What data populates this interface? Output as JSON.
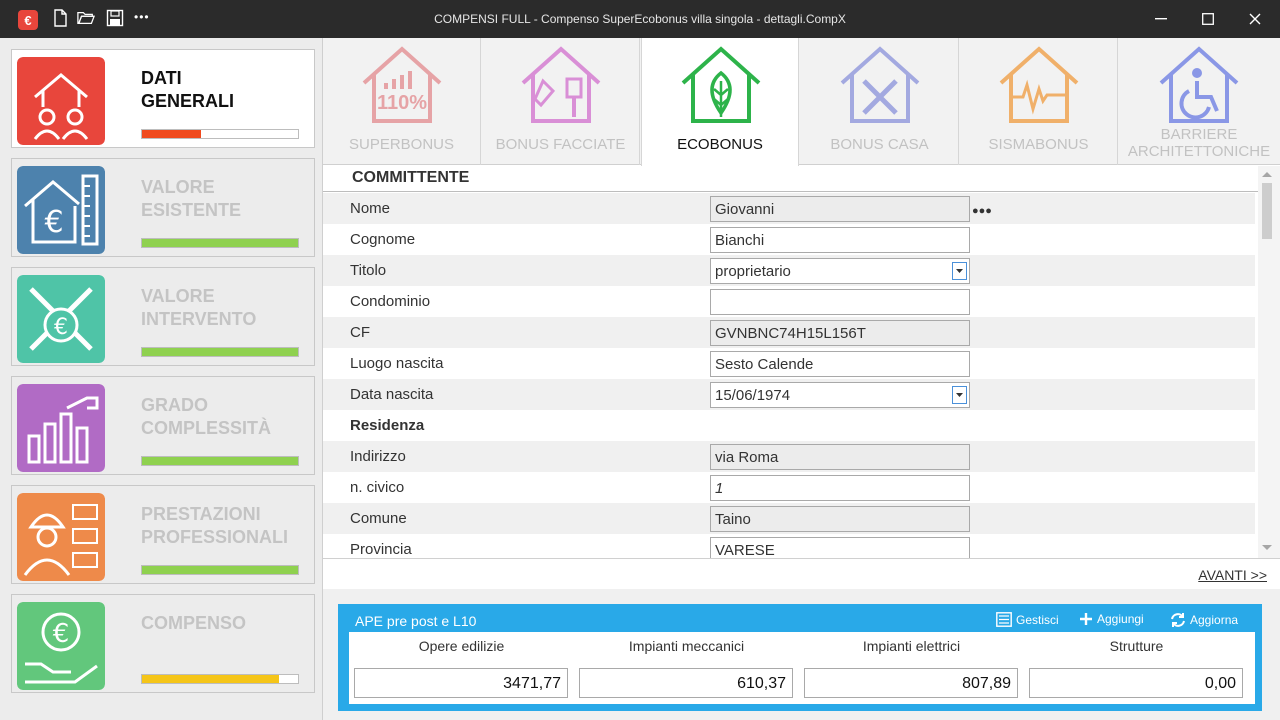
{
  "window": {
    "title": "COMPENSI FULL - Compenso SuperEcobonus villa singola - dettagli.CompX",
    "logo_glyph": "€",
    "more_glyph": "•••"
  },
  "sidebar": {
    "items": [
      {
        "label": "DATI\nGENERALI",
        "icon": "house-workers-icon",
        "color": "#e8463c",
        "progress": 0.38,
        "bar_color": "#f04a1e",
        "active": true
      },
      {
        "label": "VALORE\nESISTENTE",
        "icon": "house-euro-ruler-icon",
        "color": "#4d82ad",
        "progress": 1.0,
        "bar_color": "#8fd14f",
        "active": false
      },
      {
        "label": "VALORE\nINTERVENTO",
        "icon": "tools-euro-icon",
        "color": "#4fc4a7",
        "progress": 1.0,
        "bar_color": "#8fd14f",
        "active": false
      },
      {
        "label": "GRADO\nCOMPLESSITÀ",
        "icon": "bar-graph-icon",
        "color": "#b16bc5",
        "progress": 1.0,
        "bar_color": "#8fd14f",
        "active": false
      },
      {
        "label": "PRESTAZIONI\nPROFESSIONALI",
        "icon": "worker-invoice-icon",
        "color": "#ee8a4a",
        "progress": 1.0,
        "bar_color": "#8fd14f",
        "active": false
      },
      {
        "label": "COMPENSO",
        "icon": "hand-euro-icon",
        "color": "#62c77c",
        "progress": 0.88,
        "bar_color": "#f5c518",
        "active": false
      }
    ]
  },
  "tabs": [
    {
      "label": "SUPERBONUS",
      "icon": "house-110-icon",
      "color": "#e6a3a6",
      "active": false,
      "badge": "110%"
    },
    {
      "label": "BONUS FACCIATE",
      "icon": "house-paint-icon",
      "color": "#d98fd6",
      "active": false
    },
    {
      "label": "ECOBONUS",
      "icon": "house-leaf-icon",
      "color": "#2db34a",
      "active": true
    },
    {
      "label": "BONUS CASA",
      "icon": "house-tools-icon",
      "color": "#a3a9e0",
      "active": false
    },
    {
      "label": "SISMABONUS",
      "icon": "house-seismic-icon",
      "color": "#f0b06a",
      "active": false
    },
    {
      "label": "BARRIERE\nARCHITETTONICHE",
      "icon": "house-wheelchair-icon",
      "color": "#8a97e6",
      "active": false
    }
  ],
  "form": {
    "section_title": "COMMITTENTE",
    "rows": [
      {
        "label": "Nome",
        "value": "Giovanni",
        "readonly": true,
        "shade": true,
        "dots": "●●●"
      },
      {
        "label": "Cognome",
        "value": "Bianchi",
        "readonly": false,
        "shade": false
      },
      {
        "label": "Titolo",
        "value": "proprietario",
        "readonly": false,
        "shade": true,
        "dropdown": true
      },
      {
        "label": "Condominio",
        "value": "",
        "readonly": false,
        "shade": false
      },
      {
        "label": "CF",
        "value": "GVNBNC74H15L156T",
        "readonly": true,
        "shade": true
      },
      {
        "label": "Luogo nascita",
        "value": "Sesto Calende",
        "readonly": false,
        "shade": false
      },
      {
        "label": "Data nascita",
        "value": "15/06/1974",
        "readonly": false,
        "shade": true,
        "dropdown": true
      },
      {
        "label": "Residenza",
        "bold": true,
        "shade": false,
        "header": true
      },
      {
        "label": "Indirizzo",
        "value": "via Roma",
        "readonly": true,
        "shade": true
      },
      {
        "label": "n. civico",
        "value": "1",
        "readonly": false,
        "shade": false,
        "italic": true
      },
      {
        "label": "Comune",
        "value": "Taino",
        "readonly": true,
        "shade": true
      },
      {
        "label": "Provincia",
        "value": "VARESE",
        "readonly": false,
        "shade": false
      }
    ]
  },
  "nav": {
    "next_label": "AVANTI >>"
  },
  "ape": {
    "title": "APE pre post e L10",
    "actions": {
      "manage": "Gestisci",
      "add": "Aggiungi",
      "refresh": "Aggiorna"
    },
    "columns": [
      {
        "header": "Opere edilizie",
        "value": "3471,77"
      },
      {
        "header": "Impianti meccanici",
        "value": "610,37"
      },
      {
        "header": "Impianti elettrici",
        "value": "807,89"
      },
      {
        "header": "Strutture",
        "value": "0,00"
      }
    ]
  }
}
